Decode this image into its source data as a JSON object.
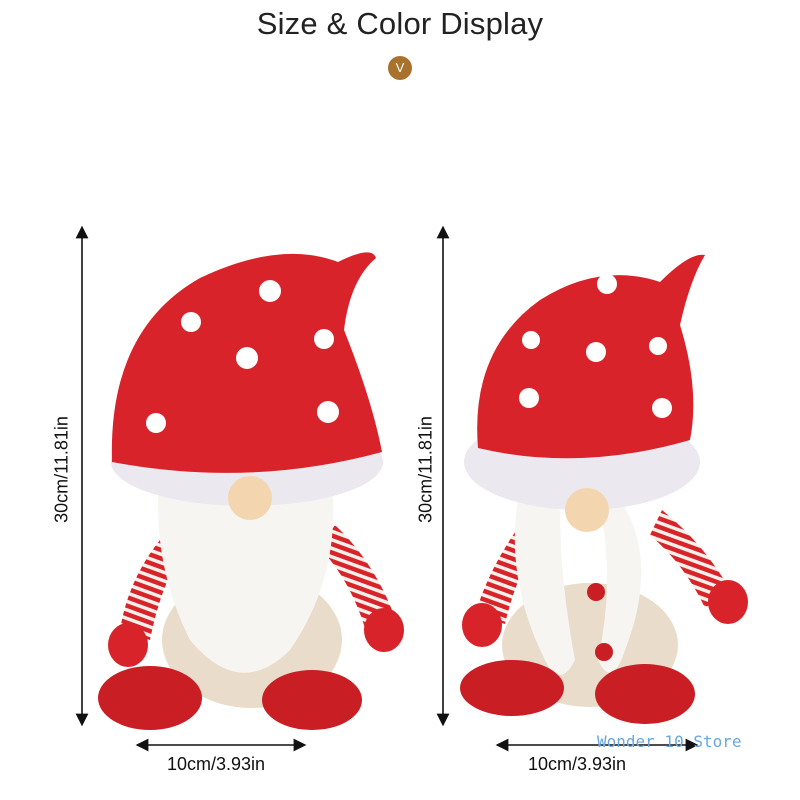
{
  "header": {
    "title": "Size & Color Display",
    "badge_glyph": "V"
  },
  "products": [
    {
      "height_label": "30cm/11.81in",
      "width_label": "10cm/3.93in"
    },
    {
      "height_label": "30cm/11.81in",
      "width_label": "10cm/3.93in"
    }
  ],
  "watermark": "Wonder 10 Store",
  "colors": {
    "hat_red": "#d8232a",
    "dots": "#ffffff",
    "beard": "#f7f5f2",
    "nose": "#f3d6b0",
    "badge": "#a8722c"
  }
}
